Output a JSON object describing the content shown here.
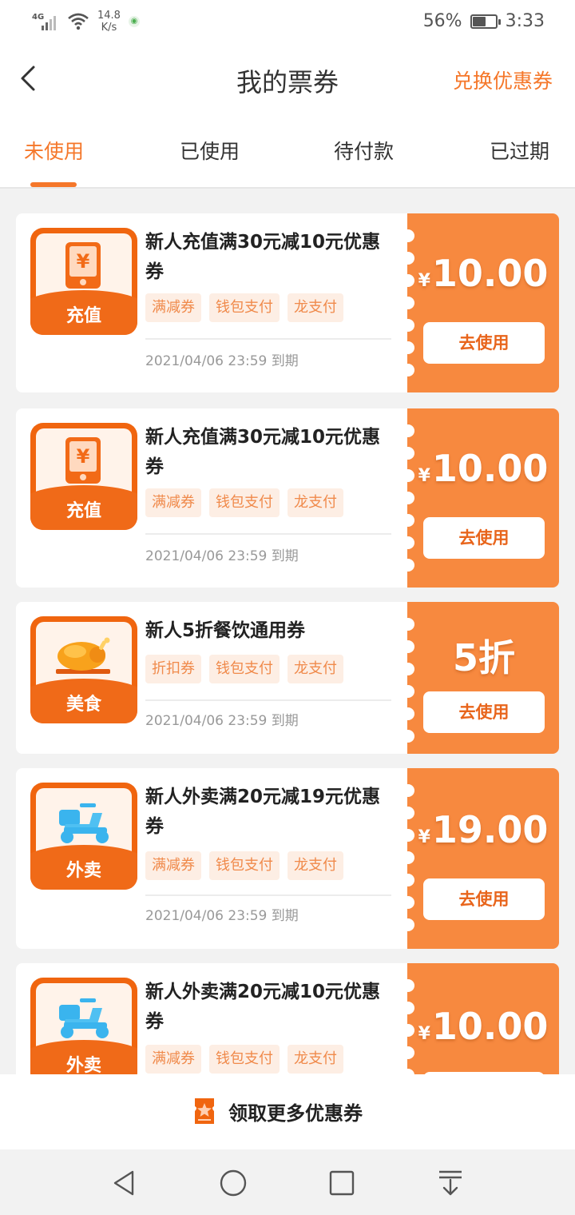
{
  "status_bar": {
    "network": "4G",
    "speed_value": "14.8",
    "speed_unit": "K/s",
    "battery": "56%",
    "battery_level": 0.56,
    "time": "3:33"
  },
  "nav": {
    "title": "我的票券",
    "action": "兑换优惠券"
  },
  "tabs": [
    {
      "label": "未使用",
      "active": true
    },
    {
      "label": "已使用",
      "active": false
    },
    {
      "label": "待付款",
      "active": false
    },
    {
      "label": "已过期",
      "active": false
    }
  ],
  "coupons": [
    {
      "icon_label": "充值",
      "icon": "phone-recharge-icon",
      "title_line1": "新人充值满30元减10元优惠",
      "title_line2": "券",
      "tags": [
        "满减券",
        "钱包支付",
        "龙支付"
      ],
      "expiry": "2021/04/06 23:59 到期",
      "currency": "¥",
      "amount": "10.00",
      "button": "去使用"
    },
    {
      "icon_label": "充值",
      "icon": "phone-recharge-icon",
      "title_line1": "新人充值满30元减10元优惠",
      "title_line2": "券",
      "tags": [
        "满减券",
        "钱包支付",
        "龙支付"
      ],
      "expiry": "2021/04/06 23:59 到期",
      "currency": "¥",
      "amount": "10.00",
      "button": "去使用"
    },
    {
      "icon_label": "美食",
      "icon": "roast-chicken-icon",
      "title_line1": "新人5折餐饮通用券",
      "title_line2": "",
      "tags": [
        "折扣券",
        "钱包支付",
        "龙支付"
      ],
      "expiry": "2021/04/06 23:59 到期",
      "currency": "",
      "amount": "5折",
      "button": "去使用"
    },
    {
      "icon_label": "外卖",
      "icon": "scooter-icon",
      "title_line1": "新人外卖满20元减19元优惠",
      "title_line2": "券",
      "tags": [
        "满减券",
        "钱包支付",
        "龙支付"
      ],
      "expiry": "2021/04/06 23:59 到期",
      "currency": "¥",
      "amount": "19.00",
      "button": "去使用"
    },
    {
      "icon_label": "外卖",
      "icon": "scooter-icon",
      "title_line1": "新人外卖满20元减10元优惠",
      "title_line2": "券",
      "tags": [
        "满减券",
        "钱包支付",
        "龙支付"
      ],
      "expiry": "",
      "currency": "¥",
      "amount": "10.00",
      "button": ""
    }
  ],
  "bottom": {
    "label": "领取更多优惠券",
    "icon": "ticket-icon"
  },
  "colors": {
    "accent": "#f5772a",
    "coupon_right": "#f7893f",
    "icon_bg": "#f0650f",
    "tag_bg": "#fdeee4",
    "tag_text": "#f08a4b"
  }
}
